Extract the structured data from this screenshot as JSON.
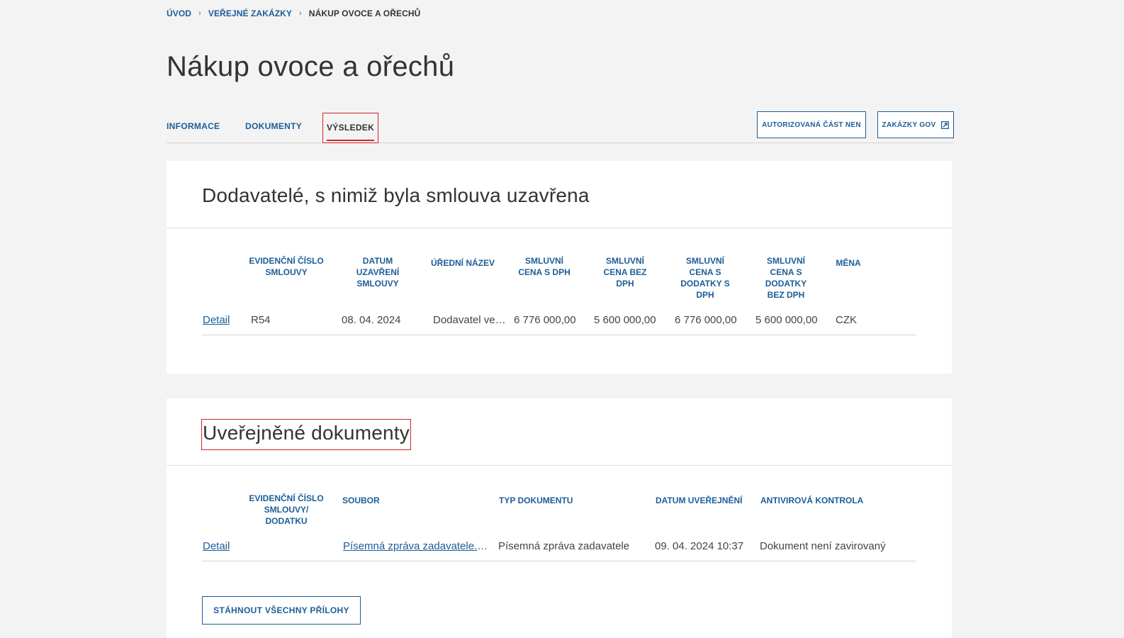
{
  "breadcrumb": {
    "home": "ÚVOD",
    "section": "VEŘEJNÉ ZAKÁZKY",
    "current": "NÁKUP OVOCE A OŘECHŮ"
  },
  "page": {
    "title": "Nákup ovoce a ořechů"
  },
  "tabs": [
    {
      "label": "INFORMACE"
    },
    {
      "label": "DOKUMENTY"
    },
    {
      "label": "VÝSLEDEK"
    }
  ],
  "header_buttons": {
    "authorized": "AUTORIZOVANÁ ČÁST NEN",
    "gov": "ZAKÁZKY GOV"
  },
  "suppliers": {
    "title": "Dodavatelé, s nimiž byla smlouva uzavřena",
    "columns": [
      "EVIDENČNÍ ČÍSLO SMLOUVY",
      "DATUM UZAVŘENÍ SMLOUVY",
      "ÚŘEDNÍ NÁZEV",
      "SMLUVNÍ CENA S DPH",
      "SMLUVNÍ CENA BEZ DPH",
      "SMLUVNÍ CENA S DODATKY S DPH",
      "SMLUVNÍ CENA S DODATKY BEZ DPH",
      "MĚNA"
    ],
    "rows": [
      {
        "detail": "Detail",
        "contract_no": "R54",
        "date": "08. 04. 2024",
        "name": "Dodavatel veřejné zakázky",
        "price_vat": "6 776 000,00",
        "price_novat": "5 600 000,00",
        "price_add_vat": "6 776 000,00",
        "price_add_novat": "5 600 000,00",
        "currency": "CZK"
      }
    ]
  },
  "documents": {
    "title": "Uveřejněné dokumenty",
    "columns": [
      "EVIDENČNÍ ČÍSLO SMLOUVY/ DODATKU",
      "SOUBOR",
      "TYP DOKUMENTU",
      "DATUM UVEŘEJNĚNÍ",
      "ANTIVIROVÁ KONTROLA"
    ],
    "rows": [
      {
        "detail": "Detail",
        "contract_no": "",
        "file": "Písemná zpráva zadavatele.pdf",
        "type": "Písemná zpráva zadavatele",
        "published": "09. 04. 2024 10:37",
        "antivirus": "Dokument není zavirovaný"
      }
    ],
    "download_all": "STÁHNOUT VŠECHNY PŘÍLOHY"
  },
  "colors": {
    "link": "#1c5d99",
    "highlight": "#d0242b"
  }
}
